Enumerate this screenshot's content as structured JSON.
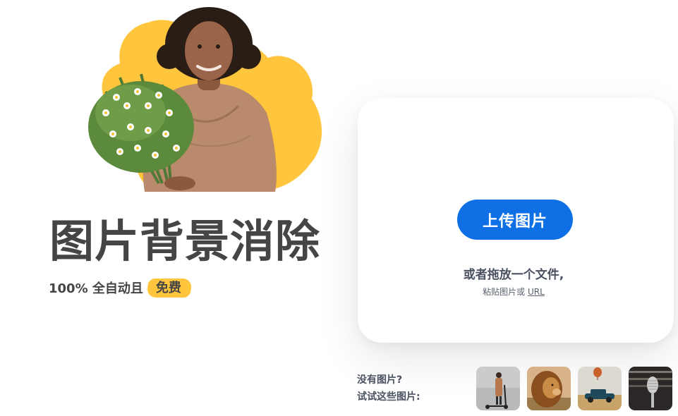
{
  "hero": {
    "image": "woman-holding-flowers",
    "blob_color": "#ffc53d"
  },
  "title": "图片背景消除",
  "subtitle": {
    "prefix": "100% 全自动且",
    "badge": "免费",
    "badge_color": "#ffc53d"
  },
  "upload": {
    "button_label": "上传图片",
    "button_color": "#0f70e6",
    "drop_text": "或者拖放一个文件,",
    "paste_prefix": "粘贴图片或 ",
    "paste_link": "URL"
  },
  "samples": {
    "line1": "没有图片?",
    "line2": "试试这些图片:",
    "items": [
      {
        "image": "woman-with-scooter"
      },
      {
        "image": "lion"
      },
      {
        "image": "vintage-car-hot-air-balloon"
      },
      {
        "image": "microphone"
      }
    ]
  }
}
